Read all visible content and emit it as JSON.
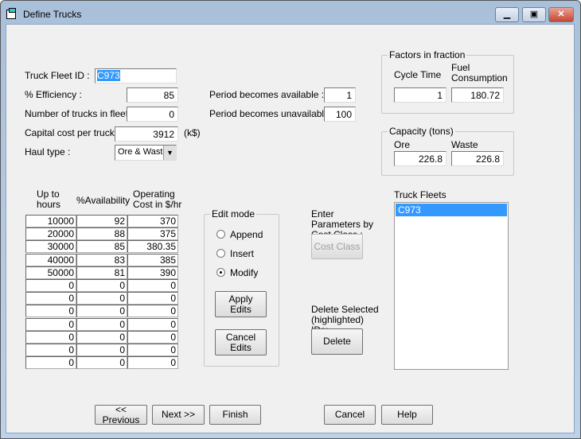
{
  "window": {
    "title": "Define Trucks",
    "minimize": "minimize",
    "maximize": "maximize",
    "close": "close"
  },
  "form": {
    "fleet_id_label": "Truck Fleet ID :",
    "fleet_id": "C973",
    "efficiency_label": "% Efficiency :",
    "efficiency": "85",
    "num_trucks_label": "Number of trucks in fleet :",
    "num_trucks": "0",
    "capital_cost_label": "Capital cost per truck:",
    "capital_cost": "3912",
    "capital_cost_unit": "(k$)",
    "haul_type_label": "Haul type :",
    "haul_type": "Ore & Waste",
    "period_available_label": "Period becomes available :",
    "period_available": "1",
    "period_unavailable_label": "Period becomes unavailable :",
    "period_unavailable": "100"
  },
  "factors": {
    "title": "Factors in fraction",
    "cycle_time_label": "Cycle Time",
    "cycle_time": "1",
    "fuel_label": "Fuel Consumption",
    "fuel": "180.72"
  },
  "capacity": {
    "title": "Capacity (tons)",
    "ore_label": "Ore",
    "ore": "226.8",
    "waste_label": "Waste",
    "waste": "226.8"
  },
  "table": {
    "headers": [
      "Up to hours",
      "%Availability",
      "Operating Cost in $/hr"
    ],
    "rows": [
      [
        "10000",
        "92",
        "370"
      ],
      [
        "20000",
        "88",
        "375"
      ],
      [
        "30000",
        "85",
        "380.35"
      ],
      [
        "40000",
        "83",
        "385"
      ],
      [
        "50000",
        "81",
        "390"
      ],
      [
        "0",
        "0",
        "0"
      ],
      [
        "0",
        "0",
        "0"
      ],
      [
        "0",
        "0",
        "0"
      ],
      [
        "0",
        "0",
        "0"
      ],
      [
        "0",
        "0",
        "0"
      ],
      [
        "0",
        "0",
        "0"
      ],
      [
        "0",
        "0",
        "0"
      ]
    ]
  },
  "edit_mode": {
    "title": "Edit mode",
    "options": [
      "Append",
      "Insert",
      "Modify"
    ],
    "selected": "Modify",
    "apply": "Apply Edits",
    "cancel": "Cancel Edits"
  },
  "cost_class": {
    "label": "Enter Parameters by Cost Class :",
    "button": "Cost Class"
  },
  "delete": {
    "label": "Delete Selected (highlighted) IDs:",
    "button": "Delete"
  },
  "fleets": {
    "title": "Truck Fleets",
    "items": [
      "C973"
    ],
    "selected": "C973"
  },
  "footer": {
    "previous": "<< Previous",
    "next": "Next >>",
    "finish": "Finish",
    "cancel": "Cancel",
    "help": "Help"
  }
}
